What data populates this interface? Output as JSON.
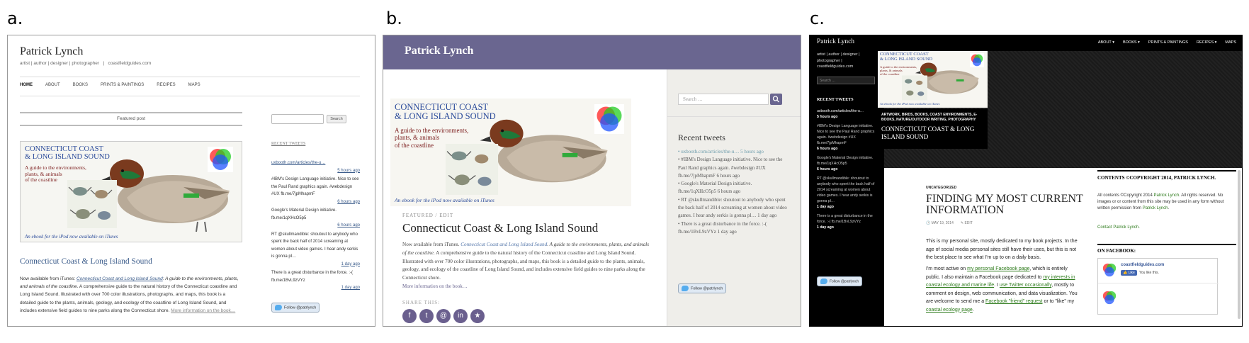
{
  "labels": {
    "a": "a.",
    "b": "b.",
    "c": "c."
  },
  "cover": {
    "title_line1": "Connecticut Coast",
    "title_line2": "& Long Island Sound",
    "sub1": "A guide to the environments,",
    "sub2": "plants, & animals",
    "sub3": "of the coastline",
    "caption": "An ebook for the iPod now available on iTunes"
  },
  "a": {
    "site_title": "Patrick Lynch",
    "tagline": "artist | author | designer | photographer   |   coastfieldguides.com",
    "nav": [
      "HOME",
      "ABOUT",
      "BOOKS",
      "PRINTS & PAINTINGS",
      "RECIPES",
      "MAPS"
    ],
    "featured": "Featured post",
    "post_title": "Connecticut Coast & Long Island Sound",
    "excerpt_1": "Now available from iTunes: ",
    "excerpt_link": "Connecticut Coast and Long Island Sound",
    "excerpt_italic": ": A guide to the environments, plants, and animals of the coastline",
    "excerpt_2": ". A comprehensive guide to the natural history of the Connecticut coastline and Long Island Sound. Illustrated with over 700 color illustrations, photographs, and maps, this book is a detailed guide to the plants, animals, geology, and ecology of the coastline of Long Island Sound, and includes extensive field guides to nine parks along the Connecticut shore. ",
    "more": "More information on the book…",
    "search_button": "Search",
    "recent_tweets": "RECENT TWEETS",
    "tweets": [
      {
        "text": "uxbooth.com/articles/the-u…",
        "time": "5 hours ago"
      },
      {
        "text": "#IBM's Design Language initiative. Nice to see the Paul Rand graphics again. #webdesign #UX fb.me/7jpMhapmF",
        "time": "6 hours ago"
      },
      {
        "text": "Google's Material Design initiative. fb.me/1qXHcO5p5",
        "time": "6 hours ago"
      },
      {
        "text": "RT @skullmandible: shoutout to anybody who spent the back half of 2014 screaming at women about video games. I hear andy serkis is gonna pl…",
        "time": "1 day ago"
      },
      {
        "text": "There is a great disturbance in the force. :-( fb.me/1BvL9zVYz",
        "time": "1 day ago"
      }
    ],
    "follow": "Follow @patrlynch"
  },
  "b": {
    "site_title": "Patrick Lynch",
    "meta": "FEATURED / EDIT",
    "post_title": "Connecticut Coast & Long Island Sound",
    "excerpt_1": "Now available from iTunes. ",
    "excerpt_link": "Connecticut Coast and Long Island Sound",
    "excerpt_italic": ". A guide to the environments, plants, and animals of the coastline",
    "excerpt_2": ". A comprehensive guide to the natural history of the Connecticut coastline and Long Island Sound. Illustrated with over 700 color illustrations, photographs, and maps, this book is a detailed guide to the plants, animals, geology, and ecology of the coastline of Long Island Sound, and includes extensive field guides to nine parks along the Connecticut shore.",
    "more": "More information on the book…",
    "share_label": "SHARE THIS:",
    "share_icons": [
      "f",
      "t",
      "@",
      "in",
      "★"
    ],
    "search_placeholder": "Search …",
    "recent_tweets": "Recent tweets",
    "tweets": [
      "uxbooth.com/articles/the-u… 5 hours ago",
      "#IBM's Design Language initiative. Nice to see the Paul Rand graphics again. #webdesign #UX fb.me/7jpMhapmF 6 hours ago",
      "Google's Material Design initiative. fb.me/1qXHcO5p5 6 hours ago",
      "RT @skullmandible: shoutout to anybody who spent the back half of 2014 screaming at women about video games. I hear andy serkis is gonna pl… 1 day ago",
      "There is a great disturbance in the force. :-( fb.me/1BvL9zVYz 1 day ago"
    ],
    "follow": "Follow @patrlynch"
  },
  "c": {
    "site_title": "Patrick Lynch",
    "nav": [
      "ABOUT ▾",
      "BOOKS ▾",
      "PRINTS & PAINTINGS",
      "RECIPES ▾",
      "MAPS"
    ],
    "tagline": "artist | author | designer | photographer | coastfieldguides.com",
    "search_placeholder": "Search …",
    "recent_tweets": "RECENT TWEETS",
    "tweets": [
      {
        "text": "uxbooth.com/articles/the-u…",
        "time": "5 hours ago"
      },
      {
        "text": "#IBM's Design Language initiative. Nice to see the Paul Rand graphics again. #webdesign #UX fb.me/7jpMhapmF",
        "time": "6 hours ago"
      },
      {
        "text": "Google's Material Design initiative. fb.me/1qXHcO5p5",
        "time": "6 hours ago"
      },
      {
        "text": "RT @skullmandible: shoutout to anybody who spent the back half of 2014 screaming at women about video games. I hear andy serkis is gonna pl…",
        "time": "1 day ago"
      },
      {
        "text": "There is a great disturbance in the force. :-( fb.me/1BvL9zVYz",
        "time": "1 day ago"
      }
    ],
    "follow": "Follow @patrlynch",
    "featured_cats": "ARTWORK, BIRDS, BOOKS, COAST ENVIRONMENTS, E-BOOKS, NATURE/OUTDOOR WRITING, PHOTOGRAPHY",
    "featured_title": "CONNECTICUT COAST & LONG ISLAND SOUND",
    "cat": "UNCATEGORIZED",
    "post_title": "FINDING MY MOST CURRENT INFORMATION",
    "date": "MAY 19, 2014",
    "edit": "EDIT",
    "p1": "This is my personal site, mostly dedicated to my book projects. In the age of social media personal sites still have their uses, but this is not the best place to see what I'm up to on a daily basis.",
    "p2_a": "I'm most active on ",
    "p2_link1": "my personal Facebook page",
    "p2_b": ", which is entirely public. I also maintain a Facebook page dedicated to ",
    "p2_link2": "my interests in coastal ecology and marine life",
    "p2_c": ". I ",
    "p2_link3": "use Twitter occasionally",
    "p2_d": ", mostly to comment on design, web communication, and data visualization. You are welcome to send me a ",
    "p2_link4": "Facebook \"friend\" request",
    "p2_e": " or to \"like\" my ",
    "p2_link5": "coastal ecology page",
    "p2_f": ".",
    "copyright_title": "CONTENTS ©COPYRIGHT 2014, PATRICK LYNCH.",
    "copyright_a": "All contents ©Copyright 2014 ",
    "copyright_link": "Patrick Lynch",
    "copyright_b": ". All rights reserved. No images or or content from this site may be used in any form without written permission from ",
    "copyright_link2": "Patrick Lynch",
    "copyright_c": ".",
    "contact": "Contact Patrick Lynch.",
    "on_facebook": "ON FACEBOOK:",
    "fb_name": "coastfieldguides.com",
    "fb_like": "Like",
    "fb_like_text": "You like this."
  },
  "colors": {
    "b_header": "#6a6690",
    "c_green": "#2c7a1a",
    "tweet_blue": "#55acee"
  }
}
